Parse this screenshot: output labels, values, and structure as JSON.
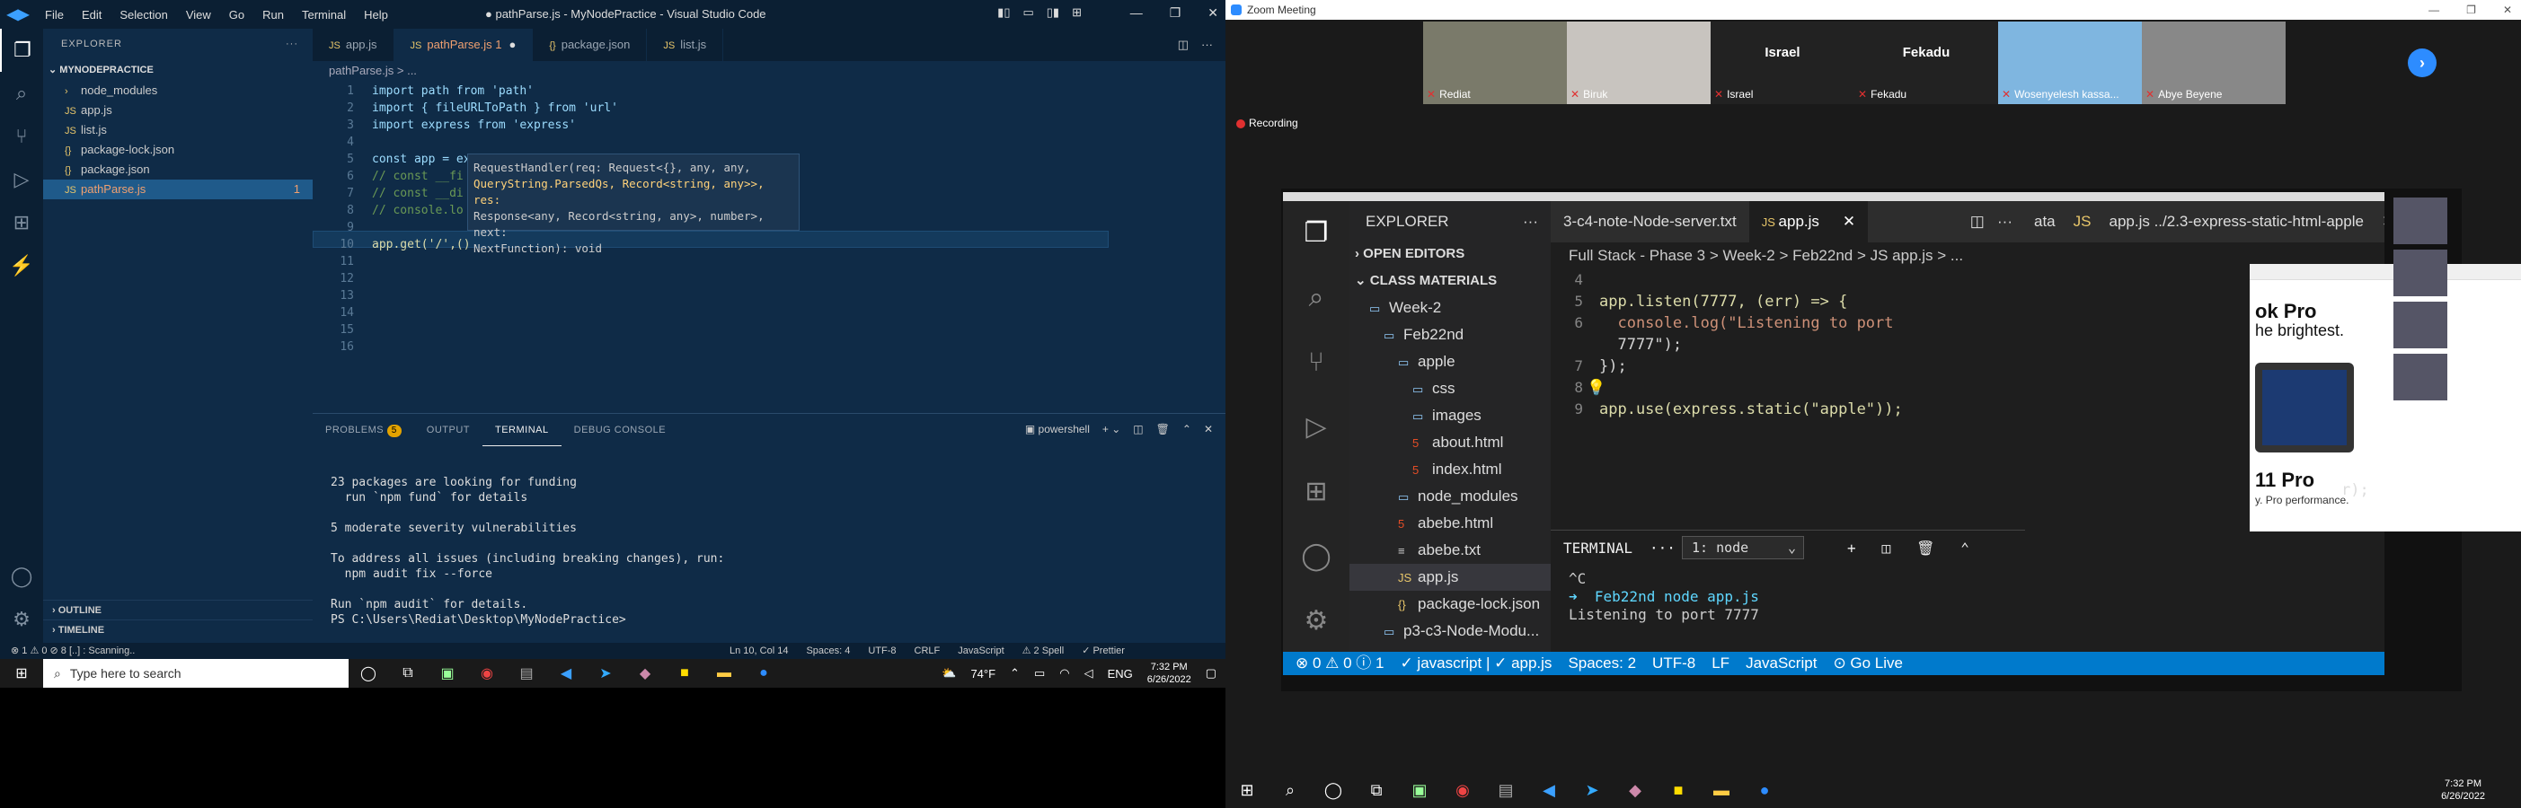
{
  "vscode": {
    "logo": "◀▶",
    "menu": [
      "File",
      "Edit",
      "Selection",
      "View",
      "Go",
      "Run",
      "Terminal",
      "Help"
    ],
    "window_title": "● pathParse.js - MyNodePractice - Visual Studio Code",
    "explorer_label": "EXPLORER",
    "project": "MYNODEPRACTICE",
    "files": [
      {
        "name": "node_modules",
        "icon": "›"
      },
      {
        "name": "app.js",
        "icon": "JS"
      },
      {
        "name": "list.js",
        "icon": "JS"
      },
      {
        "name": "package-lock.json",
        "icon": "{}"
      },
      {
        "name": "package.json",
        "icon": "{}"
      },
      {
        "name": "pathParse.js",
        "icon": "JS",
        "badge": "1"
      }
    ],
    "outline": "OUTLINE",
    "timeline": "TIMELINE",
    "tabs": [
      "app.js",
      "pathParse.js 1",
      "package.json",
      "list.js"
    ],
    "breadcrumb": "pathParse.js > ...",
    "code_lines": [
      "import path from 'path'",
      "import { fileURLToPath } from 'url'",
      "import express from 'express'",
      "",
      "const app = express()",
      "// const __fi",
      "// const __di",
      "// console.lo",
      "",
      "app.get('/',()",
      "",
      "",
      "",
      "",
      "",
      ""
    ],
    "hover_lines": [
      "RequestHandler(req: Request<{}, any, any,",
      "QueryString.ParsedQs, Record<string, any>>, res:",
      "Response<any, Record<string, any>, number>, next:",
      "NextFunction): void"
    ],
    "panel_tabs": [
      "PROBLEMS",
      "OUTPUT",
      "TERMINAL",
      "DEBUG CONSOLE"
    ],
    "problems_count": "5",
    "terminal_shell": "powershell",
    "terminal_lines": [
      "23 packages are looking for funding",
      "  run `npm fund` for details",
      "",
      "5 moderate severity vulnerabilities",
      "",
      "To address all issues (including breaking changes), run:",
      "  npm audit fix --force",
      "",
      "Run `npm audit` for details.",
      "PS C:\\Users\\Rediat\\Desktop\\MyNodePractice> "
    ],
    "status_left": "⊗ 1 ⚠ 0 ⊘ 8    [..] : Scanning..",
    "status_right": [
      "Ln 10, Col 14",
      "Spaces: 4",
      "UTF-8",
      "CRLF",
      "JavaScript",
      "⚠ 2 Spell",
      "✓ Prettier"
    ]
  },
  "taskbar_left": {
    "search_placeholder": "Type here to search",
    "weather": "74°F",
    "lang": "ENG",
    "time": "7:32 PM",
    "date": "6/26/2022"
  },
  "zoom": {
    "title": "Zoom Meeting",
    "participants": [
      {
        "tile": "",
        "label": "Rediat"
      },
      {
        "tile": "",
        "label": "Biruk"
      },
      {
        "tile": "Israel",
        "label": "Israel"
      },
      {
        "tile": "Fekadu",
        "label": "Fekadu"
      },
      {
        "tile": "",
        "label": "Wosenyelesh kassa..."
      },
      {
        "tile": "",
        "label": "Abye Beyene"
      }
    ],
    "recording": "Recording",
    "shared": {
      "tabs": [
        "3-c4-note-Node-server.txt",
        "app.js"
      ],
      "explorer": "EXPLORER",
      "tree": [
        {
          "label": "OPEN EDITORS",
          "type": "section"
        },
        {
          "label": "CLASS MATERIALS",
          "type": "section"
        },
        {
          "label": "Week-2",
          "type": "folder"
        },
        {
          "label": "Feb22nd",
          "type": "folder"
        },
        {
          "label": "apple",
          "type": "folder"
        },
        {
          "label": "css",
          "type": "folder"
        },
        {
          "label": "images",
          "type": "folder"
        },
        {
          "label": "about.html",
          "type": "html"
        },
        {
          "label": "index.html",
          "type": "html"
        },
        {
          "label": "node_modules",
          "type": "folder"
        },
        {
          "label": "abebe.html",
          "type": "html"
        },
        {
          "label": "abebe.txt",
          "type": "txt"
        },
        {
          "label": "app.js",
          "type": "js"
        },
        {
          "label": "package-lock.json",
          "type": "json"
        },
        {
          "label": "p3-c3-Node-Modu...",
          "type": "folder"
        }
      ],
      "breadcrumb": "Full Stack - Phase 3 > Week-2 > Feb22nd > JS app.js > ...",
      "line_numbers": [
        "4",
        "5",
        "6",
        "",
        "7",
        "8",
        "9"
      ],
      "code": [
        "",
        "app.listen(7777, (err) => {",
        "  console.log(\"Listening to port",
        "  7777\");",
        "});",
        "",
        "app.use(express.static(\"apple\"));"
      ],
      "terminal_label": "TERMINAL",
      "terminal_select": "1: node",
      "terminal_lines": [
        "^C",
        "➜  Feb22nd node app.js",
        "Listening to port 7777",
        ""
      ],
      "status": [
        "⊗ 0 ⚠ 0 ⓘ 1",
        "✓ javascript | ✓ app.js",
        "Spaces: 2",
        "UTF-8",
        "LF",
        "JavaScript",
        "⊙ Go Live"
      ],
      "right_tabs": [
        "ata",
        "app.js ../2.3-express-static-html-apple"
      ],
      "apple_title": "ok Pro",
      "apple_sub": "he brightest.",
      "apple_title2": "11 Pro",
      "apple_sub2": "y. Pro performance.",
      "right_code": "r);"
    },
    "taskbar_time": "7:32 PM",
    "taskbar_date": "6/26/2022"
  }
}
